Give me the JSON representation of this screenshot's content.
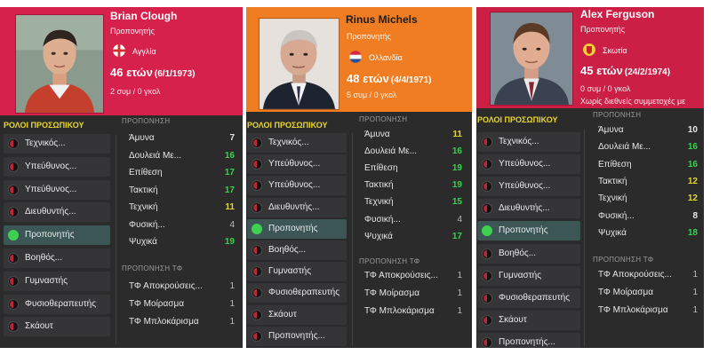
{
  "colors": {
    "card1_header": "#d5214c",
    "card2_header": "#f07d22",
    "card3_header": "#cc1f45",
    "panel": "#2b2b2c",
    "green": "#39d24f",
    "yellow": "#e6d630"
  },
  "cards": [
    {
      "name": "Brian Clough",
      "role": "Προπονητής",
      "country": "Αγγλία",
      "flag": "england-flag-icon",
      "age": "46 ετών",
      "dob": "(6/1/1973)",
      "caps": "2 συμ / 0 γκολ",
      "note": "",
      "roles_heading": "ΡΟΛΟΙ ΠΡΟΣΩΠΙΚΟΥ",
      "roles": [
        "Τεχνικός...",
        "Υπεύθυνος...",
        "Υπεύθυνος...",
        "Διευθυντής...",
        "Προπονητής",
        "Βοηθός...",
        "Γυμναστής",
        "Φυσιοθεραπευτής",
        "Σκάουτ"
      ],
      "active_role_index": 4,
      "training_title": "ΠΡΟΠΟΝΗΣΗ",
      "training": [
        {
          "label": "Άμυνα",
          "value": "7"
        },
        {
          "label": "Δουλειά Με...",
          "value": "16"
        },
        {
          "label": "Επίθεση",
          "value": "17"
        },
        {
          "label": "Τακτική",
          "value": "17"
        },
        {
          "label": "Τεχνική",
          "value": "11"
        },
        {
          "label": "Φυσική...",
          "value": "4"
        },
        {
          "label": "Ψυχικά",
          "value": "19"
        }
      ],
      "gk_title": "ΠΡΟΠΟΝΗΣΗ ΤΦ",
      "gk": [
        {
          "label": "ΤΦ Αποκρούσεις...",
          "value": "1"
        },
        {
          "label": "ΤΦ Μοίρασμα",
          "value": "1"
        },
        {
          "label": "ΤΦ Μπλοκάρισμα",
          "value": "1"
        }
      ]
    },
    {
      "name": "Rinus Michels",
      "role": "Προπονητής",
      "country": "Ολλανδία",
      "flag": "netherlands-flag-icon",
      "age": "48 ετών",
      "dob": "(4/4/1971)",
      "caps": "5 συμ / 0 γκολ",
      "note": "",
      "roles_heading": "ΡΟΛΟΙ ΠΡΟΣΩΠΙΚΟΥ",
      "roles": [
        "Τεχνικός...",
        "Υπεύθυνος...",
        "Υπεύθυνος...",
        "Διευθυντής...",
        "Προπονητής",
        "Βοηθός...",
        "Γυμναστής",
        "Φυσιοθεραπευτής",
        "Σκάουτ",
        "Προπονητής..."
      ],
      "active_role_index": 4,
      "training_title": "ΠΡΟΠΟΝΗΣΗ",
      "training": [
        {
          "label": "Άμυνα",
          "value": "11"
        },
        {
          "label": "Δουλειά Με...",
          "value": "16"
        },
        {
          "label": "Επίθεση",
          "value": "19"
        },
        {
          "label": "Τακτική",
          "value": "19"
        },
        {
          "label": "Τεχνική",
          "value": "15"
        },
        {
          "label": "Φυσική...",
          "value": "4"
        },
        {
          "label": "Ψυχικά",
          "value": "17"
        }
      ],
      "gk_title": "ΠΡΟΠΟΝΗΣΗ ΤΦ",
      "gk": [
        {
          "label": "ΤΦ Αποκρούσεις...",
          "value": "1"
        },
        {
          "label": "ΤΦ Μοίρασμα",
          "value": "1"
        },
        {
          "label": "ΤΦ Μπλοκάρισμα",
          "value": "1"
        }
      ]
    },
    {
      "name": "Alex Ferguson",
      "role": "Προπονητής",
      "country": "Σκωτία",
      "flag": "scotland-flag-icon",
      "age": "45 ετών",
      "dob": "(24/2/1974)",
      "caps": "0 συμ / 0 γκολ",
      "note": "Χωρίς διεθνείς συμμετοχές με",
      "roles_heading": "ΡΟΛΟΙ ΠΡΟΣΩΠΙΚΟΥ",
      "roles": [
        "Τεχνικός...",
        "Υπεύθυνος...",
        "Υπεύθυνος...",
        "Διευθυντής...",
        "Προπονητής",
        "Βοηθός...",
        "Γυμναστής",
        "Φυσιοθεραπευτής",
        "Σκάουτ",
        "Προπονητής..."
      ],
      "active_role_index": 4,
      "training_title": "ΠΡΟΠΟΝΗΣΗ",
      "training": [
        {
          "label": "Άμυνα",
          "value": "10"
        },
        {
          "label": "Δουλειά Με...",
          "value": "16"
        },
        {
          "label": "Επίθεση",
          "value": "16"
        },
        {
          "label": "Τακτική",
          "value": "12"
        },
        {
          "label": "Τεχνική",
          "value": "12"
        },
        {
          "label": "Φυσική...",
          "value": "8"
        },
        {
          "label": "Ψυχικά",
          "value": "18"
        }
      ],
      "gk_title": "ΠΡΟΠΟΝΗΣΗ ΤΦ",
      "gk": [
        {
          "label": "ΤΦ Αποκρούσεις...",
          "value": "1"
        },
        {
          "label": "ΤΦ Μοίρασμα",
          "value": "1"
        },
        {
          "label": "ΤΦ Μπλοκάρισμα",
          "value": "1"
        }
      ]
    }
  ]
}
